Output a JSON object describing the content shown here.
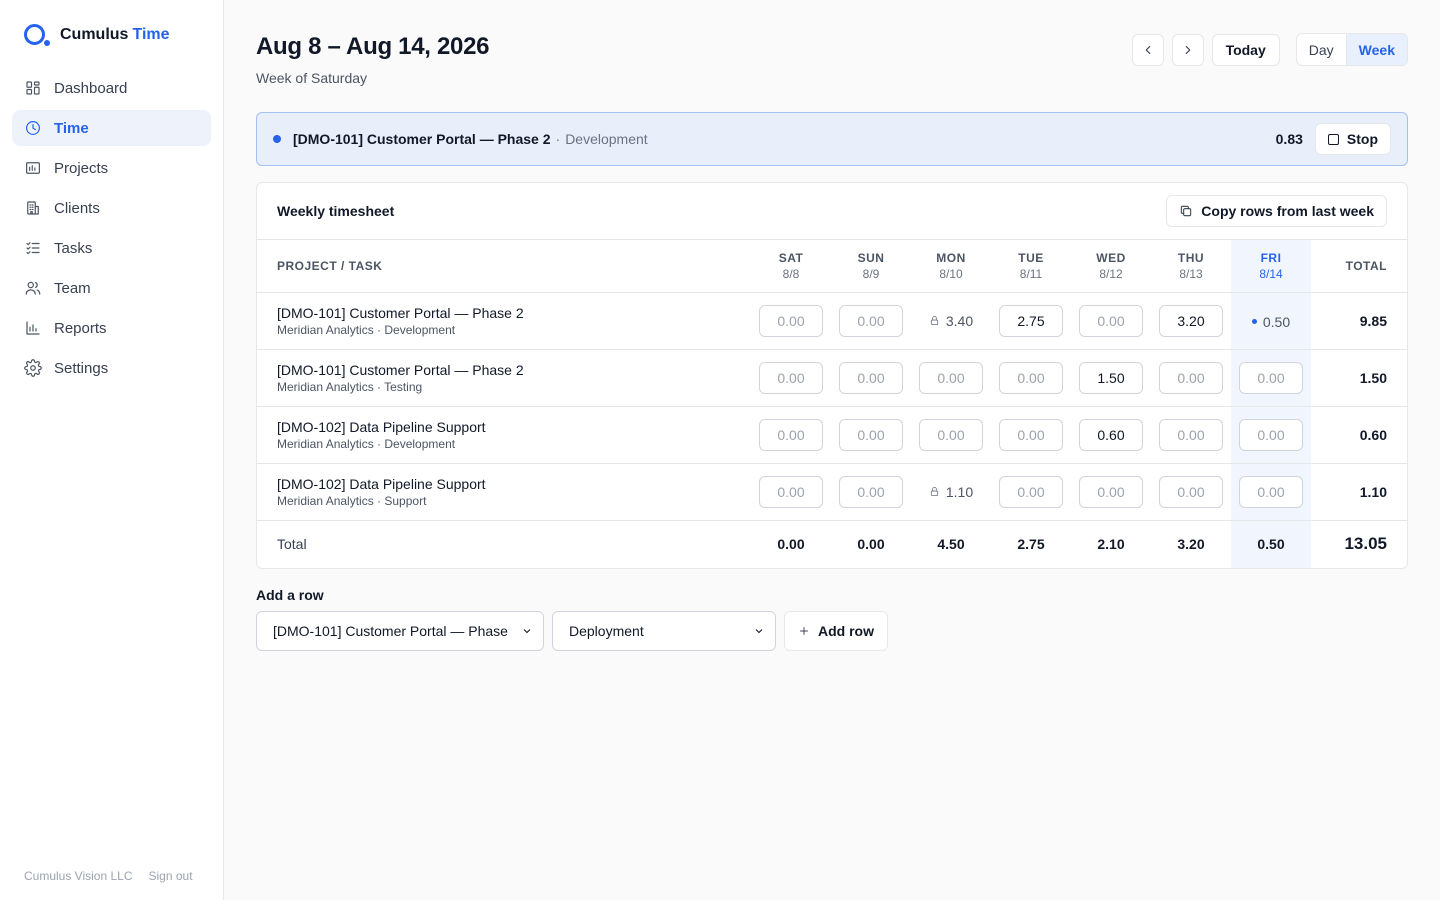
{
  "brand": {
    "name": "Cumulus",
    "accent": "Time"
  },
  "nav": [
    {
      "label": "Dashboard",
      "icon": "dashboard-icon",
      "active": false
    },
    {
      "label": "Time",
      "icon": "clock-icon",
      "active": true
    },
    {
      "label": "Projects",
      "icon": "projects-icon",
      "active": false
    },
    {
      "label": "Clients",
      "icon": "building-icon",
      "active": false
    },
    {
      "label": "Tasks",
      "icon": "checklist-icon",
      "active": false
    },
    {
      "label": "Team",
      "icon": "users-icon",
      "active": false
    },
    {
      "label": "Reports",
      "icon": "bar-chart-icon",
      "active": false
    },
    {
      "label": "Settings",
      "icon": "gear-icon",
      "active": false
    }
  ],
  "footer": {
    "company": "Cumulus Vision LLC",
    "signout": "Sign out"
  },
  "header": {
    "title": "Aug 8 – Aug 14, 2026",
    "subtitle": "Week of Saturday",
    "today": "Today",
    "views": {
      "day": "Day",
      "week": "Week"
    }
  },
  "running": {
    "project": "[DMO-101] Customer Portal — Phase 2",
    "separator": "·",
    "task": "Development",
    "hours": "0.83",
    "stop": "Stop"
  },
  "timesheet": {
    "title": "Weekly timesheet",
    "copy_label": "Copy rows from last week",
    "col_task": "Project / Task",
    "col_total": "Total",
    "days": [
      {
        "name": "SAT",
        "date": "8/8"
      },
      {
        "name": "SUN",
        "date": "8/9"
      },
      {
        "name": "MON",
        "date": "8/10"
      },
      {
        "name": "TUE",
        "date": "8/11"
      },
      {
        "name": "WED",
        "date": "8/12"
      },
      {
        "name": "THU",
        "date": "8/13"
      },
      {
        "name": "FRI",
        "date": "8/14"
      }
    ],
    "rows": [
      {
        "project": "[DMO-101] Customer Portal — Phase 2",
        "sub": "Meridian Analytics · Development",
        "cells": [
          {
            "value": "0.00",
            "kind": "empty"
          },
          {
            "value": "0.00",
            "kind": "empty"
          },
          {
            "value": "3.40",
            "kind": "locked"
          },
          {
            "value": "2.75",
            "kind": "filled"
          },
          {
            "value": "0.00",
            "kind": "empty"
          },
          {
            "value": "3.20",
            "kind": "filled"
          },
          {
            "value": "0.50",
            "kind": "running"
          }
        ],
        "total": "9.85"
      },
      {
        "project": "[DMO-101] Customer Portal — Phase 2",
        "sub": "Meridian Analytics · Testing",
        "cells": [
          {
            "value": "0.00",
            "kind": "empty"
          },
          {
            "value": "0.00",
            "kind": "empty"
          },
          {
            "value": "0.00",
            "kind": "empty"
          },
          {
            "value": "0.00",
            "kind": "empty"
          },
          {
            "value": "1.50",
            "kind": "filled"
          },
          {
            "value": "0.00",
            "kind": "empty"
          },
          {
            "value": "0.00",
            "kind": "empty"
          }
        ],
        "total": "1.50"
      },
      {
        "project": "[DMO-102] Data Pipeline Support",
        "sub": "Meridian Analytics · Development",
        "cells": [
          {
            "value": "0.00",
            "kind": "empty"
          },
          {
            "value": "0.00",
            "kind": "empty"
          },
          {
            "value": "0.00",
            "kind": "empty"
          },
          {
            "value": "0.00",
            "kind": "empty"
          },
          {
            "value": "0.60",
            "kind": "filled"
          },
          {
            "value": "0.00",
            "kind": "empty"
          },
          {
            "value": "0.00",
            "kind": "empty"
          }
        ],
        "total": "0.60"
      },
      {
        "project": "[DMO-102] Data Pipeline Support",
        "sub": "Meridian Analytics · Support",
        "cells": [
          {
            "value": "0.00",
            "kind": "empty"
          },
          {
            "value": "0.00",
            "kind": "empty"
          },
          {
            "value": "1.10",
            "kind": "locked"
          },
          {
            "value": "0.00",
            "kind": "empty"
          },
          {
            "value": "0.00",
            "kind": "empty"
          },
          {
            "value": "0.00",
            "kind": "empty"
          },
          {
            "value": "0.00",
            "kind": "empty"
          }
        ],
        "total": "1.10"
      }
    ],
    "footer": {
      "label": "Total",
      "day_totals": [
        "0.00",
        "0.00",
        "4.50",
        "2.75",
        "2.10",
        "3.20",
        "0.50"
      ],
      "grand_total": "13.05"
    }
  },
  "add_row": {
    "label": "Add a row",
    "project_select": "[DMO-101] Customer Portal — Phase",
    "task_select": "Deployment",
    "button": "Add row"
  },
  "colors": {
    "accent": "#2563eb",
    "running_bg": "#e8effb",
    "today_col": "#f1f6fe"
  }
}
